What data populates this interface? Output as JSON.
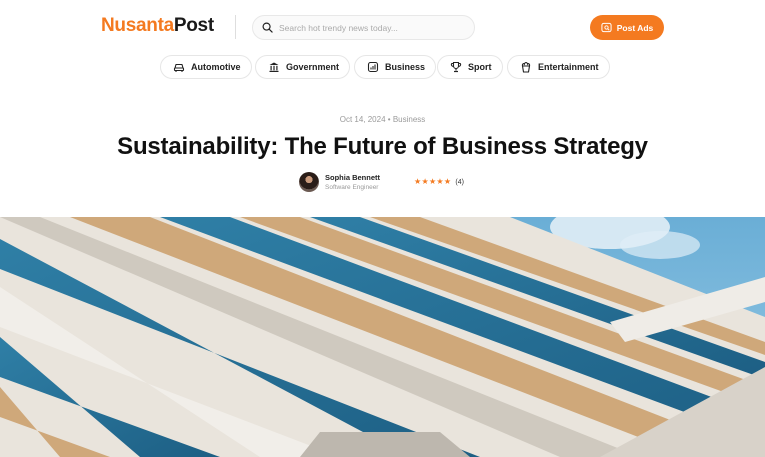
{
  "brand": {
    "part1": "Nusanta",
    "part2": "Post"
  },
  "search": {
    "placeholder": "Search hot trendy news today..."
  },
  "header": {
    "post_ads_label": "Post Ads"
  },
  "categories": [
    {
      "label": "Automotive",
      "icon": "car-icon"
    },
    {
      "label": "Government",
      "icon": "bank-icon"
    },
    {
      "label": "Business",
      "icon": "chart-icon"
    },
    {
      "label": "Sport",
      "icon": "trophy-icon"
    },
    {
      "label": "Entertainment",
      "icon": "popcorn-icon"
    }
  ],
  "article": {
    "date": "Oct 14, 2024",
    "separator": "•",
    "category": "Business",
    "title": "Sustainability: The Future of Business Strategy",
    "author": {
      "name": "Sophia Bennett",
      "role": "Software Engineer"
    },
    "rating": {
      "stars": "★★★★★",
      "count": "(4)",
      "value": 5
    }
  },
  "colors": {
    "accent": "#f47a20",
    "text": "#111111",
    "muted": "#9a9a9a"
  }
}
